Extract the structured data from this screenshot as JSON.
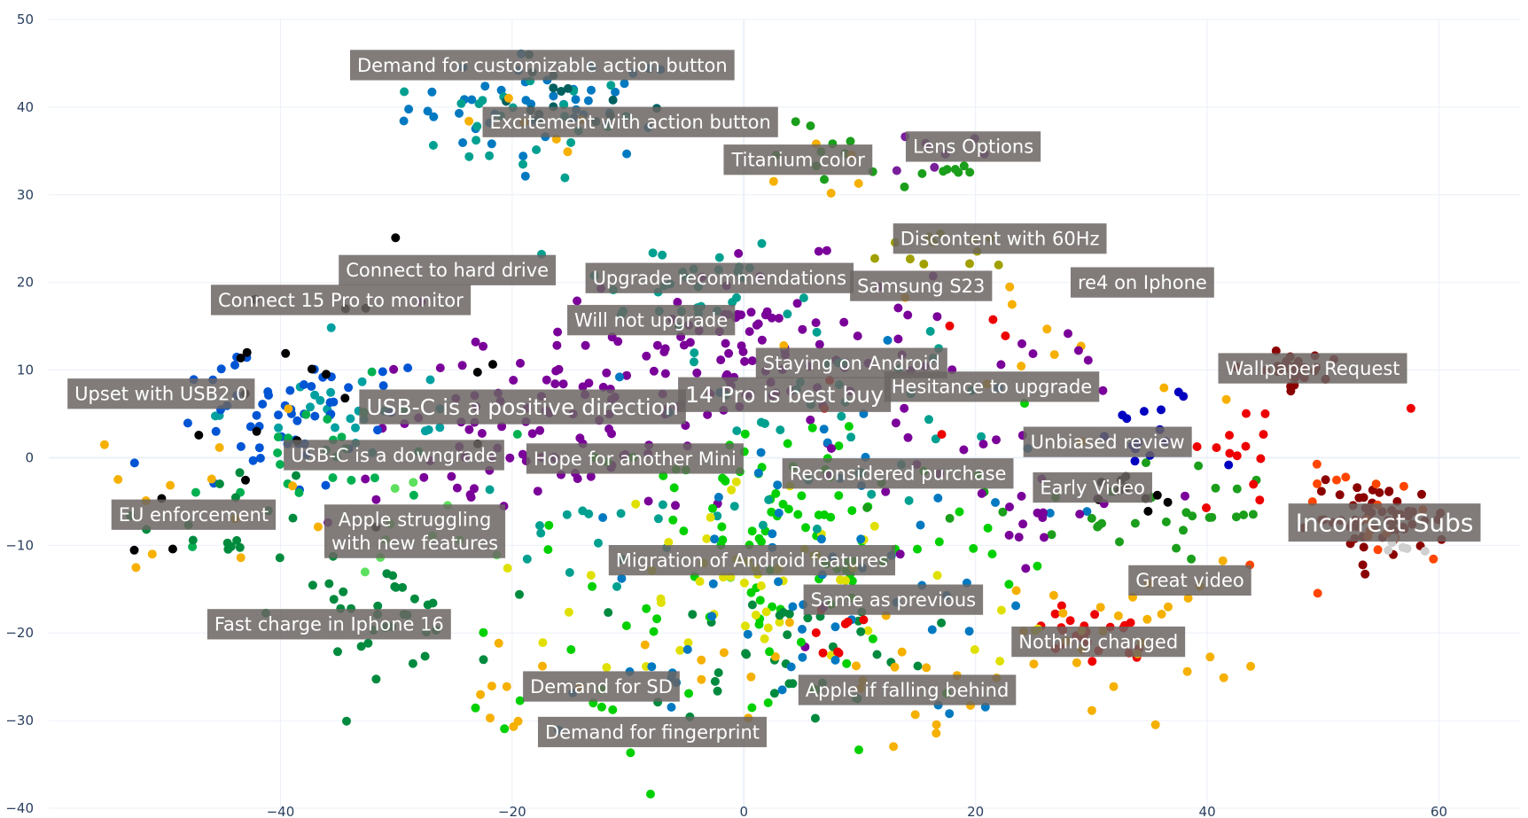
{
  "chart_data": {
    "type": "scatter",
    "title": "",
    "xlabel": "",
    "ylabel": "",
    "xlim": [
      -60,
      67
    ],
    "ylim": [
      -40,
      50
    ],
    "x_ticks": [
      "−40",
      "−20",
      "0",
      "20",
      "40",
      "60"
    ],
    "y_ticks": [
      "50",
      "40",
      "30",
      "20",
      "10",
      "0",
      "−10",
      "−20",
      "−30",
      "−40"
    ],
    "x_tick_values": [
      -40,
      -20,
      0,
      20,
      40,
      60
    ],
    "y_tick_values": [
      50,
      40,
      30,
      20,
      10,
      0,
      -10,
      -20,
      -30,
      -40
    ],
    "grid": true,
    "legend": "none",
    "clusters": [
      {
        "color": "#0079c1",
        "cx": -17,
        "cy": 40,
        "sx": 6,
        "sy": 3,
        "n": 45
      },
      {
        "color": "#00a090",
        "cx": -19,
        "cy": 38,
        "sx": 5,
        "sy": 3,
        "n": 25
      },
      {
        "color": "#006060",
        "cx": -16,
        "cy": 41,
        "sx": 4,
        "sy": 2,
        "n": 15
      },
      {
        "color": "#f5b000",
        "cx": -20,
        "cy": 36,
        "sx": 4,
        "sy": 3,
        "n": 6
      },
      {
        "color": "#1b9e1b",
        "cx": 8,
        "cy": 34,
        "sx": 3,
        "sy": 2,
        "n": 10
      },
      {
        "color": "#f5b000",
        "cx": 6,
        "cy": 33,
        "sx": 3,
        "sy": 2,
        "n": 5
      },
      {
        "color": "#7a1f9a",
        "cx": 17,
        "cy": 35,
        "sx": 2,
        "sy": 1.5,
        "n": 8
      },
      {
        "color": "#1b9e1b",
        "cx": 17,
        "cy": 33,
        "sx": 2,
        "sy": 1.5,
        "n": 8
      },
      {
        "color": "#00a090",
        "cx": -6,
        "cy": 20,
        "sx": 5,
        "sy": 3,
        "n": 30
      },
      {
        "color": "#a0a000",
        "cx": 20,
        "cy": 24,
        "sx": 4,
        "sy": 1.5,
        "n": 12
      },
      {
        "color": "#7a0099",
        "cx": 0,
        "cy": 12,
        "sx": 8,
        "sy": 5,
        "n": 110
      },
      {
        "color": "#7a0099",
        "cx": -18,
        "cy": 5,
        "sx": 7,
        "sy": 4,
        "n": 50
      },
      {
        "color": "#7a0099",
        "cx": -20,
        "cy": 0,
        "sx": 8,
        "sy": 4,
        "n": 30
      },
      {
        "color": "#00a0a0",
        "cx": -33,
        "cy": 5,
        "sx": 6,
        "sy": 3,
        "n": 25
      },
      {
        "color": "#0055d4",
        "cx": -42,
        "cy": 3,
        "sx": 4,
        "sy": 4,
        "n": 40
      },
      {
        "color": "#0055d4",
        "cx": -35,
        "cy": 6,
        "sx": 4,
        "sy": 3,
        "n": 15
      },
      {
        "color": "#00b050",
        "cx": -34,
        "cy": 0,
        "sx": 6,
        "sy": 4,
        "n": 25
      },
      {
        "color": "#f5b000",
        "cx": -46,
        "cy": -4,
        "sx": 6,
        "sy": 5,
        "n": 14
      },
      {
        "color": "#008a3e",
        "cx": -44,
        "cy": -6,
        "sx": 4,
        "sy": 3,
        "n": 16
      },
      {
        "color": "#000000",
        "cx": -36,
        "cy": 6,
        "sx": 10,
        "sy": 8,
        "n": 22
      },
      {
        "color": "#008a3e",
        "cx": -32,
        "cy": -18,
        "sx": 4,
        "sy": 3,
        "n": 35
      },
      {
        "color": "#5de05d",
        "cx": -28,
        "cy": -8,
        "sx": 4,
        "sy": 3,
        "n": 10
      },
      {
        "color": "#00a090",
        "cx": -14,
        "cy": -8,
        "sx": 5,
        "sy": 3,
        "n": 15
      },
      {
        "color": "#00d000",
        "cx": 4,
        "cy": -8,
        "sx": 10,
        "sy": 7,
        "n": 90
      },
      {
        "color": "#e0e000",
        "cx": 0,
        "cy": -14,
        "sx": 7,
        "sy": 6,
        "n": 50
      },
      {
        "color": "#008a3e",
        "cx": 4,
        "cy": -22,
        "sx": 6,
        "sy": 4,
        "n": 35
      },
      {
        "color": "#0079c1",
        "cx": 6,
        "cy": -10,
        "sx": 10,
        "sy": 10,
        "n": 50
      },
      {
        "color": "#ee0000",
        "cx": 7,
        "cy": -20,
        "sx": 1.5,
        "sy": 1.5,
        "n": 8
      },
      {
        "color": "#f5b000",
        "cx": 8,
        "cy": -25,
        "sx": 6,
        "sy": 5,
        "n": 20
      },
      {
        "color": "#1b9e1b",
        "cx": 40,
        "cy": -6,
        "sx": 3,
        "sy": 2.5,
        "n": 14
      },
      {
        "color": "#1b9e1b",
        "cx": 28,
        "cy": -7,
        "sx": 8,
        "sy": 3,
        "n": 18
      },
      {
        "color": "#7a0099",
        "cx": 25,
        "cy": -6,
        "sx": 4,
        "sy": 2,
        "n": 10
      },
      {
        "color": "#000000",
        "cx": 34,
        "cy": -5,
        "sx": 1.5,
        "sy": 1.5,
        "n": 10
      },
      {
        "color": "#0000c0",
        "cx": 35,
        "cy": 2,
        "sx": 3,
        "sy": 3,
        "n": 15
      },
      {
        "color": "#ee0000",
        "cx": 30,
        "cy": -20,
        "sx": 3,
        "sy": 2,
        "n": 25
      },
      {
        "color": "#f5b000",
        "cx": 33,
        "cy": -20,
        "sx": 5,
        "sy": 4,
        "n": 30
      },
      {
        "color": "#e0e000",
        "cx": 24,
        "cy": -19,
        "sx": 3,
        "sy": 2,
        "n": 5
      },
      {
        "color": "#ee0000",
        "cx": 43,
        "cy": 0,
        "sx": 2,
        "sy": 3,
        "n": 12
      },
      {
        "color": "#8b0000",
        "cx": 47,
        "cy": 10,
        "sx": 1.5,
        "sy": 1,
        "n": 30
      },
      {
        "color": "#8b0000",
        "cx": 55,
        "cy": -7,
        "sx": 3,
        "sy": 2,
        "n": 60
      },
      {
        "color": "#ff4500",
        "cx": 55,
        "cy": -7,
        "sx": 4,
        "sy": 3,
        "n": 18
      },
      {
        "color": "#cfcfcf",
        "cx": 57,
        "cy": -10,
        "sx": 1,
        "sy": 0.8,
        "n": 6
      },
      {
        "color": "#f5b000",
        "cx": 26,
        "cy": 12,
        "sx": 6,
        "sy": 5,
        "n": 12
      },
      {
        "color": "#00a090",
        "cx": 8,
        "cy": 5,
        "sx": 7,
        "sy": 6,
        "n": 40
      },
      {
        "color": "#7a0099",
        "cx": 18,
        "cy": -4,
        "sx": 10,
        "sy": 6,
        "n": 20
      },
      {
        "color": "#f5b000",
        "cx": -18,
        "cy": -28,
        "sx": 6,
        "sy": 5,
        "n": 10
      },
      {
        "color": "#00d000",
        "cx": -10,
        "cy": -25,
        "sx": 10,
        "sy": 6,
        "n": 25
      },
      {
        "color": "#0079c1",
        "cx": -4,
        "cy": -25,
        "sx": 6,
        "sy": 5,
        "n": 15
      },
      {
        "color": "#ee0000",
        "cx": 25,
        "cy": 10,
        "sx": 12,
        "sy": 6,
        "n": 8
      },
      {
        "color": "#7a0099",
        "cx": 28,
        "cy": 10,
        "sx": 4,
        "sy": 3,
        "n": 6
      }
    ],
    "annotations": [
      {
        "text": "Demand for customizable action button",
        "x": -17.4,
        "y": 44.8,
        "fs": 21
      },
      {
        "text": "Excitement with action button",
        "x": -9.8,
        "y": 38.3,
        "fs": 21
      },
      {
        "text": "Titanium color",
        "x": 4.7,
        "y": 34.0,
        "fs": 21
      },
      {
        "text": "Lens Options",
        "x": 19.8,
        "y": 35.5,
        "fs": 21
      },
      {
        "text": "Discontent with 60Hz",
        "x": 22.1,
        "y": 25.0,
        "fs": 21
      },
      {
        "text": "re4 on Iphone",
        "x": 34.4,
        "y": 20.0,
        "fs": 21
      },
      {
        "text": "Connect to hard drive",
        "x": -25.6,
        "y": 21.4,
        "fs": 21
      },
      {
        "text": "Upgrade recommendations",
        "x": -2.1,
        "y": 20.5,
        "fs": 21
      },
      {
        "text": "Samsung S23",
        "x": 15.3,
        "y": 19.6,
        "fs": 21
      },
      {
        "text": "Connect 15 Pro to monitor",
        "x": -34.8,
        "y": 18.0,
        "fs": 21
      },
      {
        "text": "Will not upgrade",
        "x": -8.0,
        "y": 15.7,
        "fs": 21
      },
      {
        "text": "Staying on Android",
        "x": 9.3,
        "y": 10.8,
        "fs": 21
      },
      {
        "text": "Wallpaper Request",
        "x": 49.1,
        "y": 10.2,
        "fs": 21
      },
      {
        "text": "Hesitance to upgrade",
        "x": 21.4,
        "y": 8.1,
        "fs": 21
      },
      {
        "text": "Upset with USB2.0",
        "x": -50.3,
        "y": 7.3,
        "fs": 21
      },
      {
        "text": "14 Pro is best buy",
        "x": 3.5,
        "y": 7.2,
        "fs": 25
      },
      {
        "text": "USB-C is a positive direction",
        "x": -19.1,
        "y": 5.8,
        "fs": 25
      },
      {
        "text": "Unbiased review",
        "x": 31.4,
        "y": 1.8,
        "fs": 21
      },
      {
        "text": "USB-C is a downgrade",
        "x": -30.2,
        "y": 0.3,
        "fs": 21
      },
      {
        "text": "Hope for another Mini",
        "x": -9.4,
        "y": -0.1,
        "fs": 21
      },
      {
        "text": "Reconsidered purchase",
        "x": 13.3,
        "y": -1.8,
        "fs": 21
      },
      {
        "text": "Early Video",
        "x": 30.1,
        "y": -3.4,
        "fs": 21
      },
      {
        "text": "Incorrect Subs",
        "x": 55.3,
        "y": -7.4,
        "fs": 28
      },
      {
        "text": "EU enforcement",
        "x": -47.5,
        "y": -6.5,
        "fs": 21
      },
      {
        "text": "Apple struggling\nwith new features",
        "x": -28.4,
        "y": -8.4,
        "fs": 21
      },
      {
        "text": "Migration of Android features",
        "x": 0.7,
        "y": -11.7,
        "fs": 21
      },
      {
        "text": "Great video",
        "x": 38.5,
        "y": -14.0,
        "fs": 21
      },
      {
        "text": "Same as previous",
        "x": 12.9,
        "y": -16.2,
        "fs": 21
      },
      {
        "text": "Fast charge in Iphone 16",
        "x": -35.8,
        "y": -19.0,
        "fs": 21
      },
      {
        "text": "Nothing changed",
        "x": 30.6,
        "y": -21.0,
        "fs": 21
      },
      {
        "text": "Demand for SD",
        "x": -12.3,
        "y": -26.1,
        "fs": 21
      },
      {
        "text": "Apple if falling behind",
        "x": 14.1,
        "y": -26.5,
        "fs": 21
      },
      {
        "text": "Demand for fingerprint",
        "x": -7.9,
        "y": -31.3,
        "fs": 21
      }
    ]
  }
}
